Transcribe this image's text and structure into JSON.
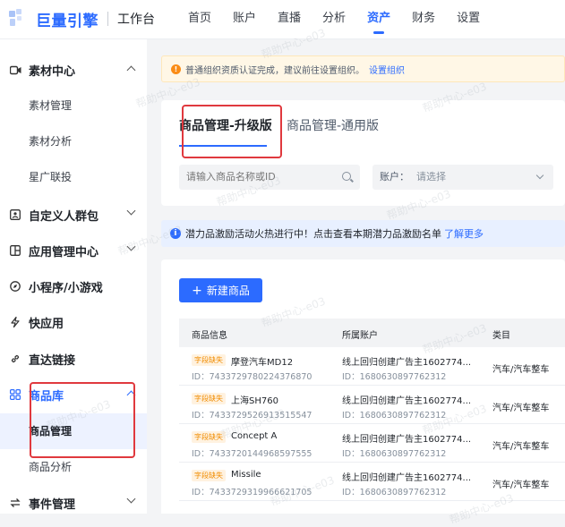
{
  "brand": {
    "name": "巨量引擎",
    "workspace": "工作台"
  },
  "nav": {
    "items": [
      "首页",
      "账户",
      "直播",
      "分析",
      "资产",
      "财务",
      "设置"
    ],
    "active": "资产"
  },
  "sidebar": {
    "sucai": {
      "label": "素材中心",
      "subs": [
        "素材管理",
        "素材分析",
        "星广联投"
      ]
    },
    "custom_audience": "自定义人群包",
    "app_center": "应用管理中心",
    "mini_program": "小程序/小游戏",
    "quick_app": "快应用",
    "direct_link": "直达链接",
    "product_lib": {
      "label": "商品库",
      "subs": [
        "商品管理",
        "商品分析"
      ]
    },
    "event_mgmt": "事件管理"
  },
  "notice": {
    "text": "普通组织资质认证完成，建议前往设置组织。",
    "link": "设置组织"
  },
  "tabs": [
    "商品管理-升级版",
    "商品管理-通用版"
  ],
  "filters": {
    "search_placeholder": "请输入商品名称或ID",
    "account_label": "账户：",
    "account_placeholder": "请选择"
  },
  "info": {
    "text": "潜力品激励活动火热进行中！点击查看本期潜力品激励名单",
    "link": "了解更多"
  },
  "new_button": "新建商品",
  "table": {
    "headers": [
      "商品信息",
      "所属账户",
      "类目"
    ],
    "rows": [
      {
        "tag": "字段缺失",
        "name": "摩登汽车MD12",
        "id": "ID：7433729780224376870",
        "account": "线上回归创建广告主1602774...",
        "account_id": "ID：1680630897762312",
        "category": "汽车/汽车整车"
      },
      {
        "tag": "字段缺失",
        "name": "上海SH760",
        "id": "ID：7433729526913515547",
        "account": "线上回归创建广告主1602774...",
        "account_id": "ID：1680630897762312",
        "category": "汽车/汽车整车"
      },
      {
        "tag": "字段缺失",
        "name": "Concept A",
        "id": "ID：7433720144968597555",
        "account": "线上回归创建广告主1602774...",
        "account_id": "ID：1680630897762312",
        "category": "汽车/汽车整车"
      },
      {
        "tag": "字段缺失",
        "name": "Missile",
        "id": "ID：7433729319966621705",
        "account": "线上回归创建广告主1602774...",
        "account_id": "ID：1680630897762312",
        "category": "汽车/汽车整车"
      }
    ]
  },
  "watermark": "帮助中心-e03",
  "colors": {
    "accent": "#2c6bff",
    "highlight": "#e0393e",
    "warning": "#fa8c16"
  }
}
